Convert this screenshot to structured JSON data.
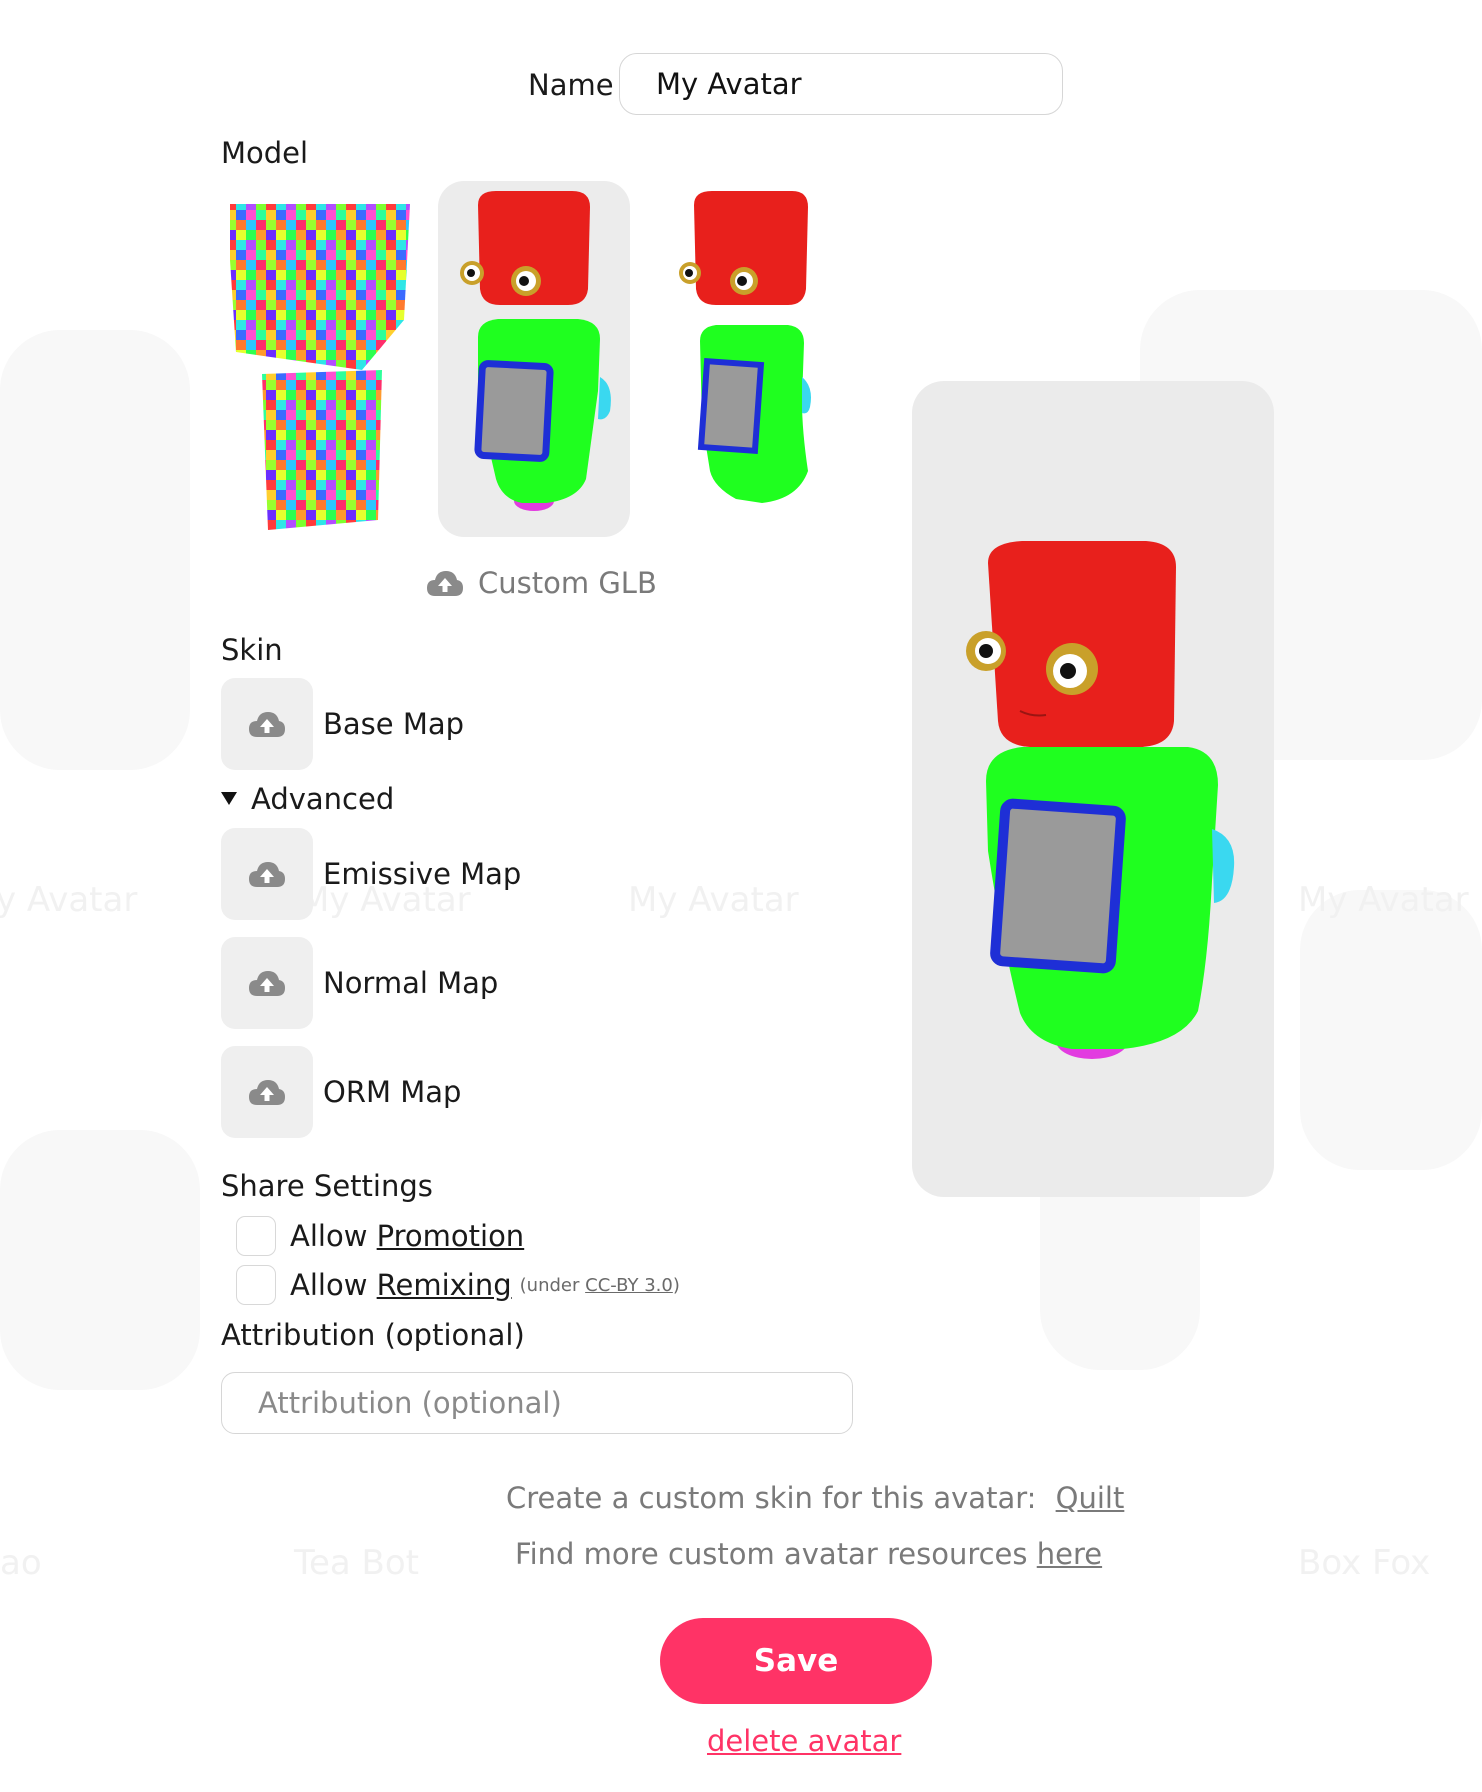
{
  "background_labels": [
    {
      "text": "y Avatar"
    },
    {
      "text": "My Avatar"
    },
    {
      "text": "My Avatar"
    },
    {
      "text": "My Avatar"
    },
    {
      "text": "ao"
    },
    {
      "text": "Tea Bot"
    },
    {
      "text": "Box Fox"
    }
  ],
  "form": {
    "name_label": "Name",
    "name_value": "My Avatar",
    "model_label": "Model",
    "custom_glb_label": "Custom GLB",
    "skin_label": "Skin",
    "base_map_label": "Base Map",
    "advanced_label": "Advanced",
    "emissive_map_label": "Emissive Map",
    "normal_map_label": "Normal Map",
    "orm_map_label": "ORM Map",
    "share_settings_label": "Share Settings",
    "allow_word": "Allow",
    "promotion_link": "Promotion",
    "remixing_link": "Remixing",
    "license_prefix": "(under ",
    "license_link": "CC-BY 3.0",
    "license_suffix": ")",
    "attribution_label": "Attribution (optional)",
    "attribution_placeholder": "Attribution (optional)",
    "quilt_text": "Create a custom skin for this avatar:",
    "quilt_link": "Quilt",
    "resources_text": "Find more custom avatar resources",
    "resources_link": "here",
    "save_label": "Save",
    "delete_label": "delete avatar"
  },
  "colors": {
    "accent": "#ff3366",
    "robot_head": "#e8201c",
    "robot_body": "#1fff1f",
    "robot_screen_border": "#1e2fd6",
    "robot_screen": "#9a9a9a",
    "robot_ear": "#3ad8f0",
    "robot_base": "#e23ce0"
  },
  "icons": {
    "upload": "cloud-upload-icon",
    "advanced_toggle": "triangle-down-icon"
  }
}
